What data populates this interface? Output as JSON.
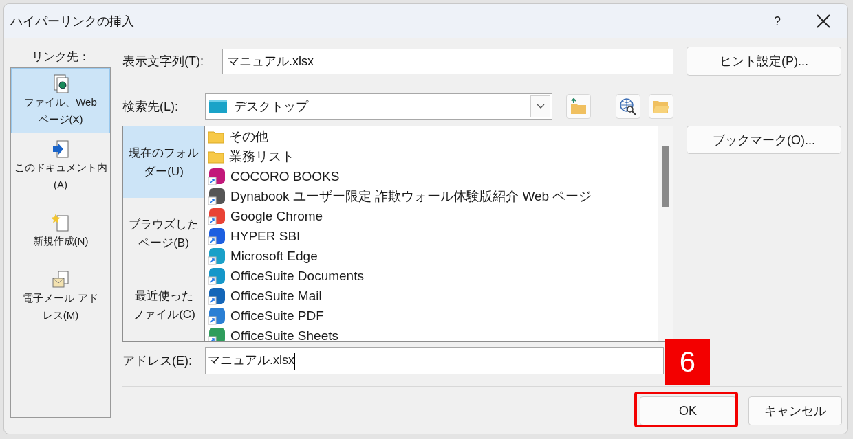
{
  "window": {
    "title": "ハイパーリンクの挿入",
    "help": "?"
  },
  "link_to": {
    "label": "リンク先：",
    "items": [
      {
        "label": "ファイル、Web ページ(X)",
        "selected": true
      },
      {
        "label": "このドキュメント内(A)",
        "selected": false
      },
      {
        "label": "新規作成(N)",
        "selected": false
      },
      {
        "label": "電子メール アドレス(M)",
        "selected": false
      }
    ]
  },
  "display_text": {
    "label": "表示文字列(T):",
    "value": "マニュアル.xlsx"
  },
  "hint_button": "ヒント設定(P)...",
  "look_in": {
    "label": "検索先(L):",
    "value": "デスクトップ"
  },
  "browse_tabs": [
    {
      "label": "現在のフォルダー(U)",
      "selected": true
    },
    {
      "label": "ブラウズしたページ(B)",
      "selected": false
    },
    {
      "label": "最近使ったファイル(C)",
      "selected": false
    }
  ],
  "files": [
    {
      "name": "その他",
      "kind": "folder"
    },
    {
      "name": "業務リスト",
      "kind": "folder"
    },
    {
      "name": "COCORO BOOKS",
      "kind": "shortcut"
    },
    {
      "name": "Dynabook ユーザー限定 詐欺ウォール体験版紹介 Web ページ",
      "kind": "shortcut"
    },
    {
      "name": "Google Chrome",
      "kind": "shortcut"
    },
    {
      "name": "HYPER SBI",
      "kind": "shortcut"
    },
    {
      "name": "Microsoft Edge",
      "kind": "shortcut"
    },
    {
      "name": "OfficeSuite Documents",
      "kind": "shortcut"
    },
    {
      "name": "OfficeSuite Mail",
      "kind": "shortcut"
    },
    {
      "name": "OfficeSuite PDF",
      "kind": "shortcut"
    },
    {
      "name": "OfficeSuite Sheets",
      "kind": "shortcut"
    }
  ],
  "bookmark_button": "ブックマーク(O)...",
  "address": {
    "label": "アドレス(E):",
    "value": "マニュアル.xlsx"
  },
  "buttons": [
    "OK",
    "キャンセル"
  ],
  "annotation": {
    "step": "6"
  }
}
